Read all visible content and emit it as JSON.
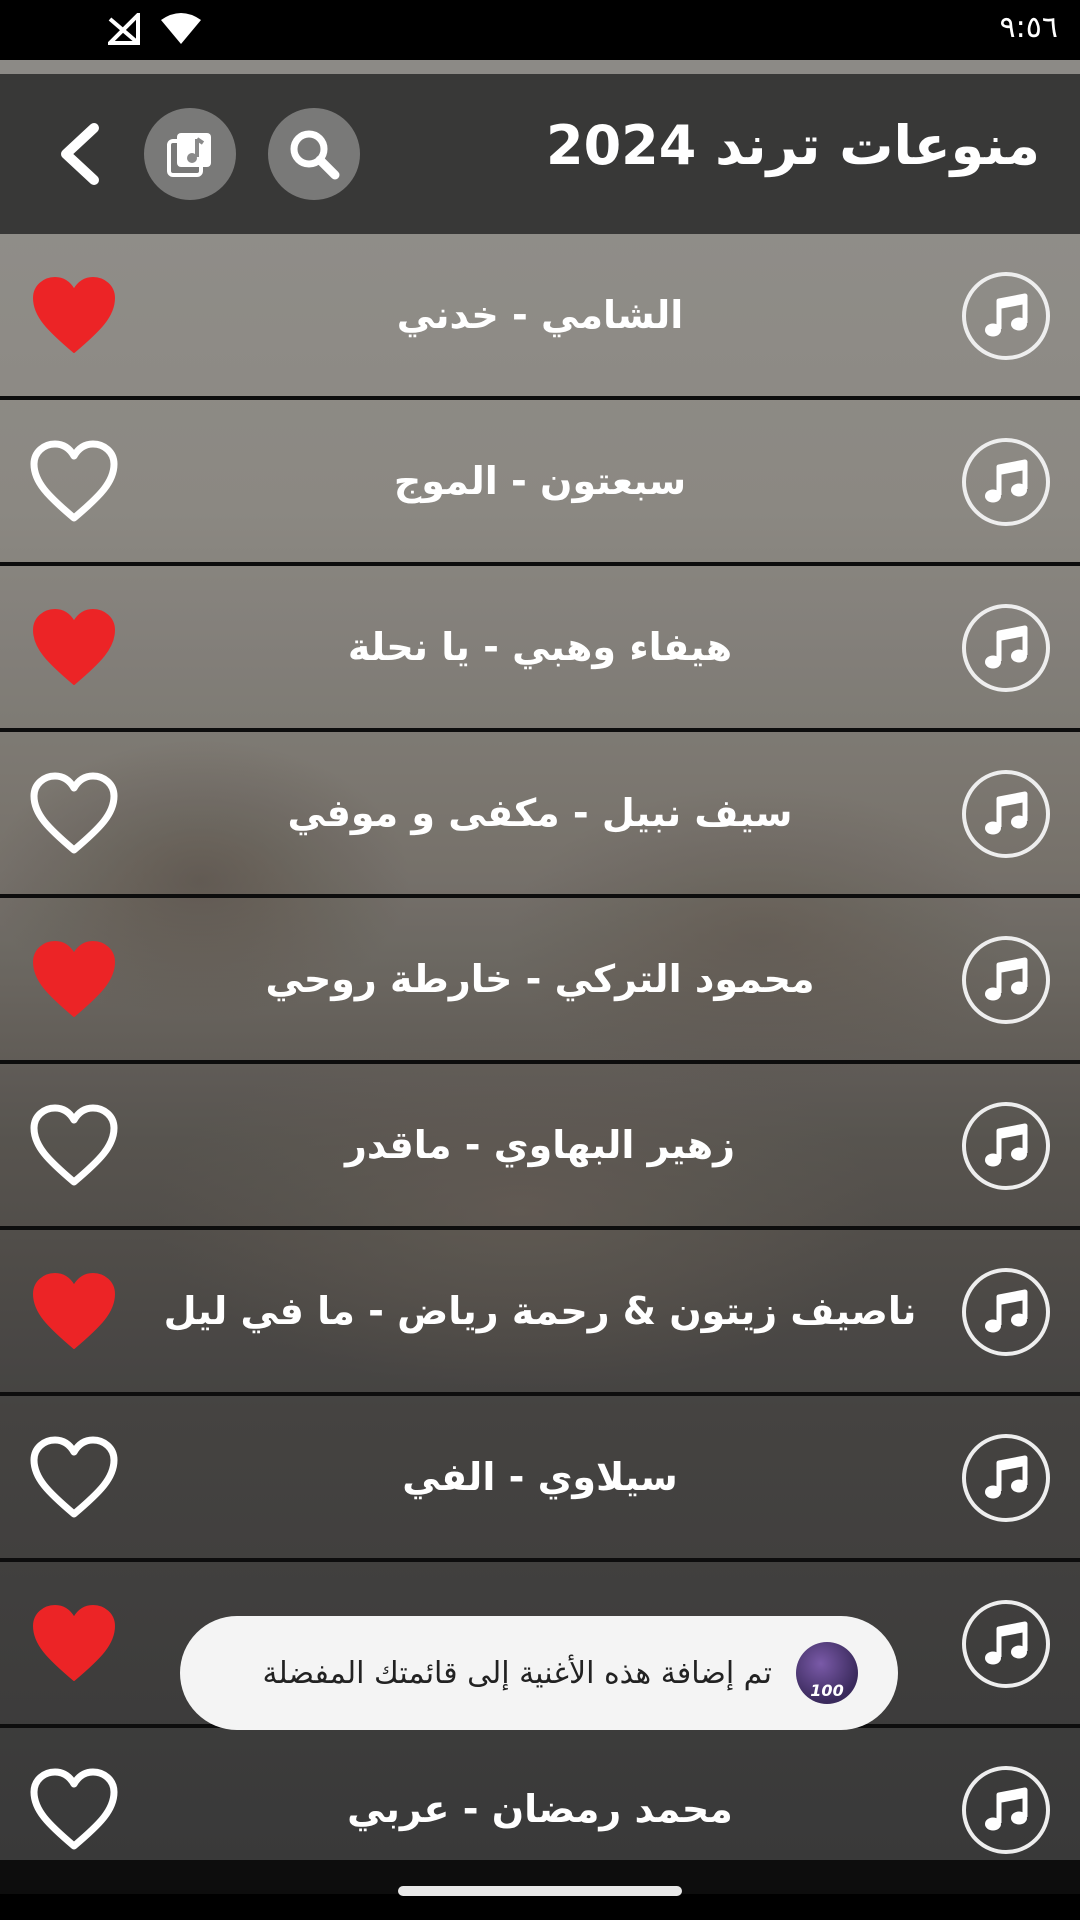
{
  "status_bar": {
    "time": "٩:٥٦"
  },
  "header": {
    "title": "منوعات ترند 2024"
  },
  "songs": [
    {
      "title": "الشامي - خدني",
      "favorite": true
    },
    {
      "title": "سبعتون - الموج",
      "favorite": false
    },
    {
      "title": "هيفاء وهبي - يا نحلة",
      "favorite": true
    },
    {
      "title": "سيف نبيل - مكفى و موفي",
      "favorite": false
    },
    {
      "title": "محمود التركي - خارطة روحي",
      "favorite": true
    },
    {
      "title": "زهير البهاوي - ماقدر",
      "favorite": false
    },
    {
      "title": "ناصيف زيتون & رحمة رياض - ما في ليل",
      "favorite": true
    },
    {
      "title": "سيلاوي - الفي",
      "favorite": false
    },
    {
      "title": "",
      "favorite": true
    },
    {
      "title": "محمد رمضان - عربي",
      "favorite": false
    }
  ],
  "toast": {
    "message": "تم إضافة هذه الأغنية إلى قائمتك المفضلة",
    "badge": "100"
  },
  "colors": {
    "heart_active": "#ec2426",
    "heart_inactive": "#ffffff",
    "header_bg": "#323232"
  }
}
